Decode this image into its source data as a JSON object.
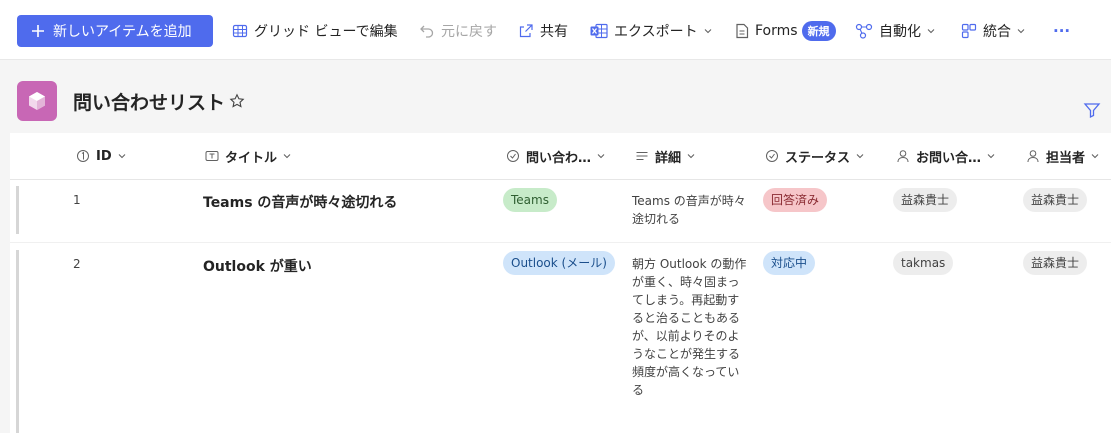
{
  "toolbar": {
    "new_item": "新しいアイテムを追加",
    "grid_edit": "グリッド ビューで編集",
    "undo": "元に戻す",
    "share": "共有",
    "export": "エクスポート",
    "forms": "Forms",
    "forms_badge": "新規",
    "automate": "自動化",
    "integrate": "統合",
    "more": "···"
  },
  "list": {
    "title": "問い合わせリスト"
  },
  "columns": {
    "id": "ID",
    "title": "タイトル",
    "inquiry": "問い合わ…",
    "detail": "詳細",
    "status": "ステータス",
    "contact": "お問い合…",
    "assignee": "担当者"
  },
  "rows": [
    {
      "id": "1",
      "title": "Teams の音声が時々途切れる",
      "inquiry": "Teams",
      "detail": "Teams の音声が時々途切れる",
      "status": "回答済み",
      "contact": "益森貴士",
      "assignee": "益森貴士"
    },
    {
      "id": "2",
      "title": "Outlook が重い",
      "inquiry": "Outlook (メール)",
      "detail": "朝方 Outlook の動作が重く、時々固まってしまう。再起動すると治ることもあるが、以前よりそのようなことが発生する頻度が高くなっている",
      "status": "対応中",
      "contact": "takmas",
      "assignee": "益森貴士"
    }
  ],
  "colors": {
    "accent": "#4f6bed",
    "list_icon": "#c867b5",
    "highlight": "#fff200"
  }
}
